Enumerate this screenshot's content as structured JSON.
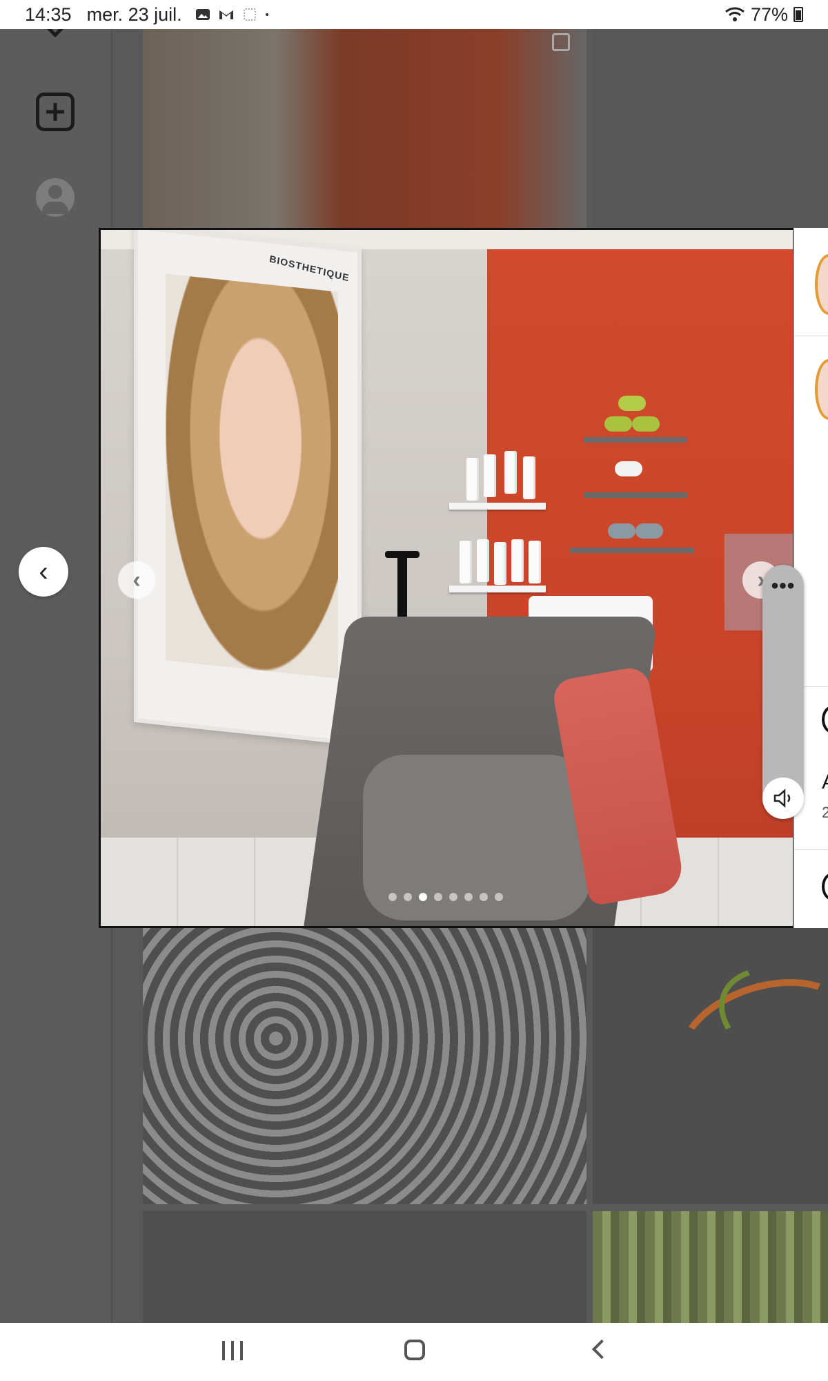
{
  "status_bar": {
    "time": "14:35",
    "date": "mer. 23 juil.",
    "icons": [
      "gallery-icon",
      "gmail-icon",
      "sim-icon",
      "dot-icon"
    ],
    "wifi": "wifi-icon",
    "battery": "77%"
  },
  "sidebar": {
    "items": [
      {
        "name": "chevron-down-icon"
      },
      {
        "name": "create-post-icon"
      },
      {
        "name": "profile-avatar"
      }
    ]
  },
  "post": {
    "poster_brand": "BIOSTHETIQUE",
    "carousel": {
      "current_index": 3,
      "total": 8,
      "prev_glyph": "‹",
      "next_glyph": "›"
    },
    "details_panel": {
      "letter": "A",
      "small_text": "2"
    }
  },
  "controls": {
    "back_glyph": "‹",
    "more_glyph": "•••",
    "volume_icon": "speaker-icon"
  },
  "nav_bar": {
    "recents": "recents-icon",
    "home": "home-icon",
    "back": "back-icon"
  }
}
